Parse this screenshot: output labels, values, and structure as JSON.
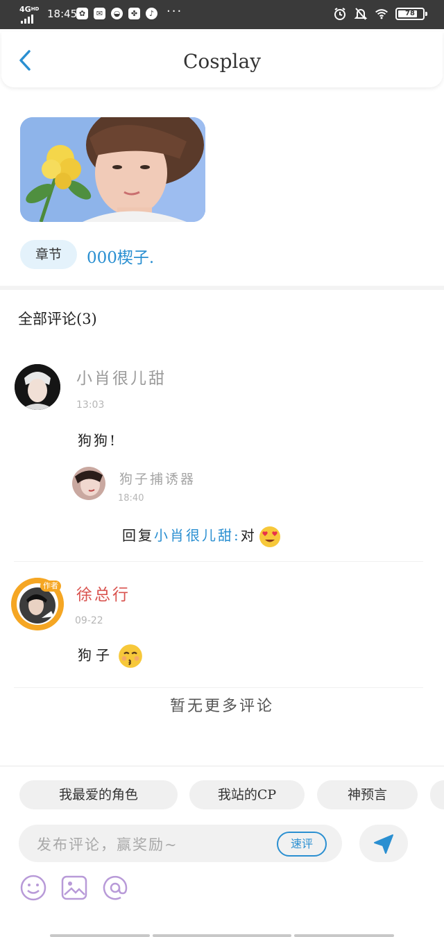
{
  "status_bar": {
    "network": "4G",
    "network_sup": "HD",
    "time": "18:45",
    "battery": "78"
  },
  "header": {
    "title": "Cosplay"
  },
  "chapter": {
    "tag": "章节",
    "name": "000楔子."
  },
  "comments_section": {
    "title": "全部评论(3)",
    "comments": [
      {
        "author": "小肖很儿甜",
        "time": "13:03",
        "text": "狗狗!",
        "reply": {
          "author": "狗子捕诱器",
          "time": "18:40",
          "prefix": "回复",
          "target": "小肖很儿甜:",
          "text": "对"
        }
      },
      {
        "author": "徐总行",
        "time": "09-22",
        "badge": "作者",
        "text": "狗子"
      }
    ],
    "no_more": "暂无更多评论"
  },
  "bottom": {
    "chips": [
      "我最爱的角色",
      "我站的CP",
      "神预言"
    ],
    "input_placeholder": "发布评论，赢奖励~",
    "quick_review": "速评"
  },
  "colors": {
    "accent": "#2a8fd1",
    "author_red": "#d9534f",
    "tool_purple": "#b89ad8"
  },
  "icons": {
    "back": "chevron-left-icon",
    "send": "send-icon",
    "emoji": "smiley-icon",
    "image": "image-icon",
    "mention": "at-icon"
  }
}
